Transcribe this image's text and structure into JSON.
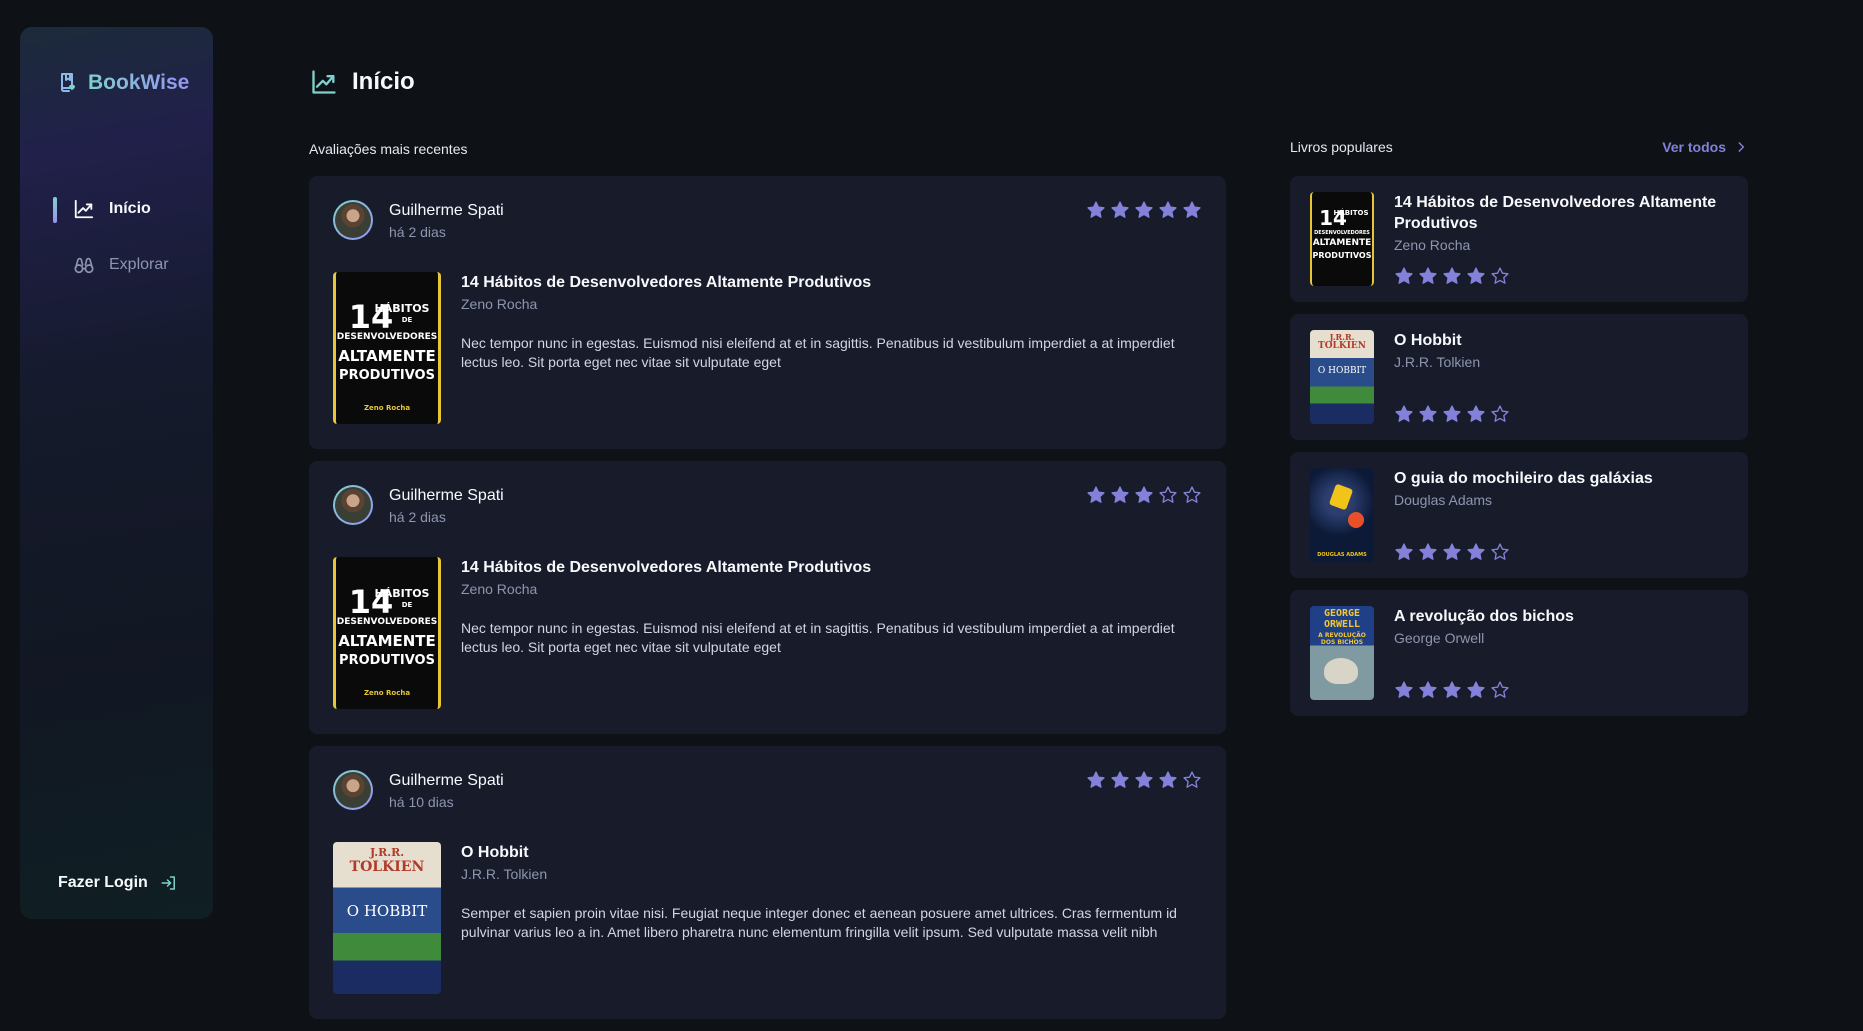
{
  "app": {
    "name": "BookWise"
  },
  "sidebar": {
    "items": [
      {
        "label": "Início",
        "icon": "chart-line-up-icon",
        "active": true
      },
      {
        "label": "Explorar",
        "icon": "binoculars-icon",
        "active": false
      }
    ],
    "login_label": "Fazer Login"
  },
  "page": {
    "title": "Início"
  },
  "feed": {
    "section_label": "Avaliações mais recentes",
    "reviews": [
      {
        "user": "Guilherme Spati",
        "date": "há 2 dias",
        "rating": 5,
        "book_title": "14 Hábitos de Desenvolvedores Altamente Produtivos",
        "book_author": "Zeno Rocha",
        "description": "Nec tempor nunc in egestas. Euismod nisi eleifend at et in sagittis. Penatibus id vestibulum imperdiet a at imperdiet lectus leo. Sit porta eget nec vitae sit vulputate eget"
      },
      {
        "user": "Guilherme Spati",
        "date": "há 2 dias",
        "rating": 3,
        "book_title": "14 Hábitos de Desenvolvedores Altamente Produtivos",
        "book_author": "Zeno Rocha",
        "description": "Nec tempor nunc in egestas. Euismod nisi eleifend at et in sagittis. Penatibus id vestibulum imperdiet a at imperdiet lectus leo. Sit porta eget nec vitae sit vulputate eget"
      },
      {
        "user": "Guilherme Spati",
        "date": "há 10 dias",
        "rating": 4,
        "book_title": "O Hobbit",
        "book_author": "J.R.R. Tolkien",
        "description": "Semper et sapien proin vitae nisi. Feugiat neque integer donec et aenean posuere amet ultrices. Cras fermentum id pulvinar varius leo a in. Amet libero pharetra nunc elementum fringilla velit ipsum. Sed vulputate massa velit nibh"
      }
    ]
  },
  "popular": {
    "title": "Livros populares",
    "see_all_label": "Ver todos",
    "books": [
      {
        "title": "14 Hábitos de Desenvolvedores Altamente Produtivos",
        "author": "Zeno Rocha",
        "rating": 4
      },
      {
        "title": "O Hobbit",
        "author": "J.R.R. Tolkien",
        "rating": 4
      },
      {
        "title": "O guia do mochileiro das galáxias",
        "author": "Douglas Adams",
        "rating": 4
      },
      {
        "title": "A revolução dos bichos",
        "author": "George Orwell",
        "rating": 4
      }
    ]
  },
  "covers": {
    "habitos": {
      "line1": "14",
      "line2": "HÁBITOS",
      "line3": "DE",
      "line4": "DESENVOLVEDORES",
      "line5": "ALTAMENTE",
      "line6": "PRODUTIVOS",
      "author": "Zeno Rocha"
    },
    "hobbit": {
      "line1": "J.R.R.",
      "line2": "TOLKIEN",
      "line3": "O HOBBIT"
    },
    "revolucao": {
      "line1": "GEORGE",
      "line2": "ORWELL",
      "line3": "A REVOLUÇÃO",
      "line4": "DOS BICHOS"
    },
    "guia": {
      "line1": "DOUGLAS ADAMS"
    }
  },
  "colors": {
    "accent": "#8381d9",
    "star": "#8381d9",
    "card": "#181c2a",
    "background": "#0e1116"
  }
}
